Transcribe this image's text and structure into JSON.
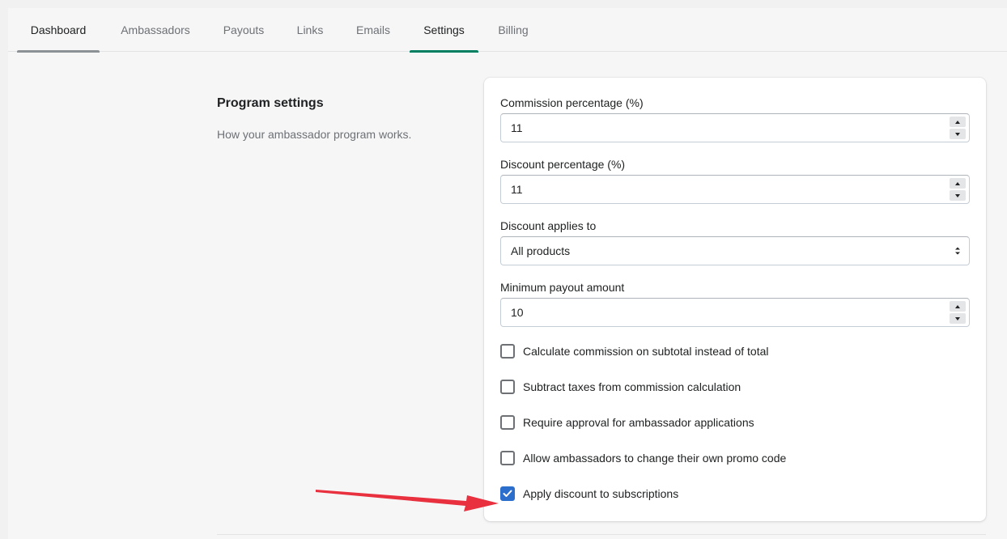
{
  "tabs": [
    {
      "label": "Dashboard"
    },
    {
      "label": "Ambassadors"
    },
    {
      "label": "Payouts"
    },
    {
      "label": "Links"
    },
    {
      "label": "Emails"
    },
    {
      "label": "Settings"
    },
    {
      "label": "Billing"
    }
  ],
  "section": {
    "title": "Program settings",
    "description": "How your ambassador program works."
  },
  "form": {
    "commission": {
      "label": "Commission percentage (%)",
      "value": "11"
    },
    "discount": {
      "label": "Discount percentage (%)",
      "value": "11"
    },
    "applies_to": {
      "label": "Discount applies to",
      "value": "All products"
    },
    "min_payout": {
      "label": "Minimum payout amount",
      "value": "10"
    },
    "checkboxes": [
      {
        "label": "Calculate commission on subtotal instead of total",
        "checked": false
      },
      {
        "label": "Subtract taxes from commission calculation",
        "checked": false
      },
      {
        "label": "Require approval for ambassador applications",
        "checked": false
      },
      {
        "label": "Allow ambassadors to change their own promo code",
        "checked": false
      },
      {
        "label": "Apply discount to subscriptions",
        "checked": true
      }
    ]
  },
  "colors": {
    "accent_green": "#008060",
    "checkbox_blue": "#2c6ecb",
    "annotation_red": "#e8303e"
  },
  "icons": [
    "chevron-up-icon",
    "chevron-down-icon",
    "select-caret-icon",
    "checkmark-icon",
    "annotation-arrow-icon"
  ]
}
